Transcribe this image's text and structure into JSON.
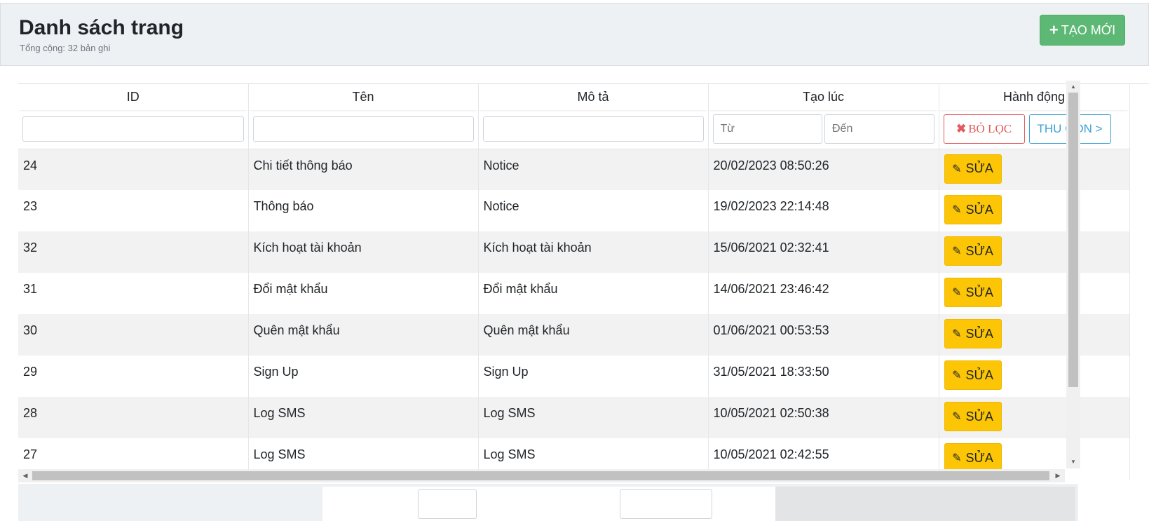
{
  "header": {
    "title": "Danh sách trang",
    "subtitle": "Tổng cộng: 32 bản ghi",
    "create_label": "TẠO MỚI",
    "create_icon": "plus-icon"
  },
  "table": {
    "columns": [
      "ID",
      "Tên",
      "Mô tả",
      "Tạo lúc",
      "Hành động"
    ],
    "filters": {
      "id": "",
      "name": "",
      "description": "",
      "date_from_placeholder": "Từ",
      "date_to_placeholder": "Đến",
      "clear_label": "BỎ LỌC",
      "collapse_label": "THU GỌN >"
    },
    "edit_label": "SỬA",
    "rows": [
      {
        "id": "24",
        "name": "Chi tiết thông báo",
        "description": "Notice",
        "created": "20/02/2023 08:50:26"
      },
      {
        "id": "23",
        "name": "Thông báo",
        "description": "Notice",
        "created": "19/02/2023 22:14:48"
      },
      {
        "id": "32",
        "name": "Kích hoạt tài khoản",
        "description": "Kích hoạt tài khoản",
        "created": "15/06/2021 02:32:41"
      },
      {
        "id": "31",
        "name": "Đổi mật khẩu",
        "description": "Đổi mật khẩu",
        "created": "14/06/2021 23:46:42"
      },
      {
        "id": "30",
        "name": "Quên mật khẩu",
        "description": "Quên mật khẩu",
        "created": "01/06/2021 00:53:53"
      },
      {
        "id": "29",
        "name": "Sign Up",
        "description": "Sign Up",
        "created": "31/05/2021 18:33:50"
      },
      {
        "id": "28",
        "name": "Log SMS",
        "description": "Log SMS",
        "created": "10/05/2021 02:50:38"
      },
      {
        "id": "27",
        "name": "Log SMS",
        "description": "Log SMS",
        "created": "10/05/2021 02:42:55"
      }
    ]
  },
  "colors": {
    "create_button": "#5cb874",
    "edit_button": "#fcc505",
    "clear_filter": "#e25b5b",
    "collapse": "#3ba1d2",
    "header_bg": "#eef1f4"
  }
}
